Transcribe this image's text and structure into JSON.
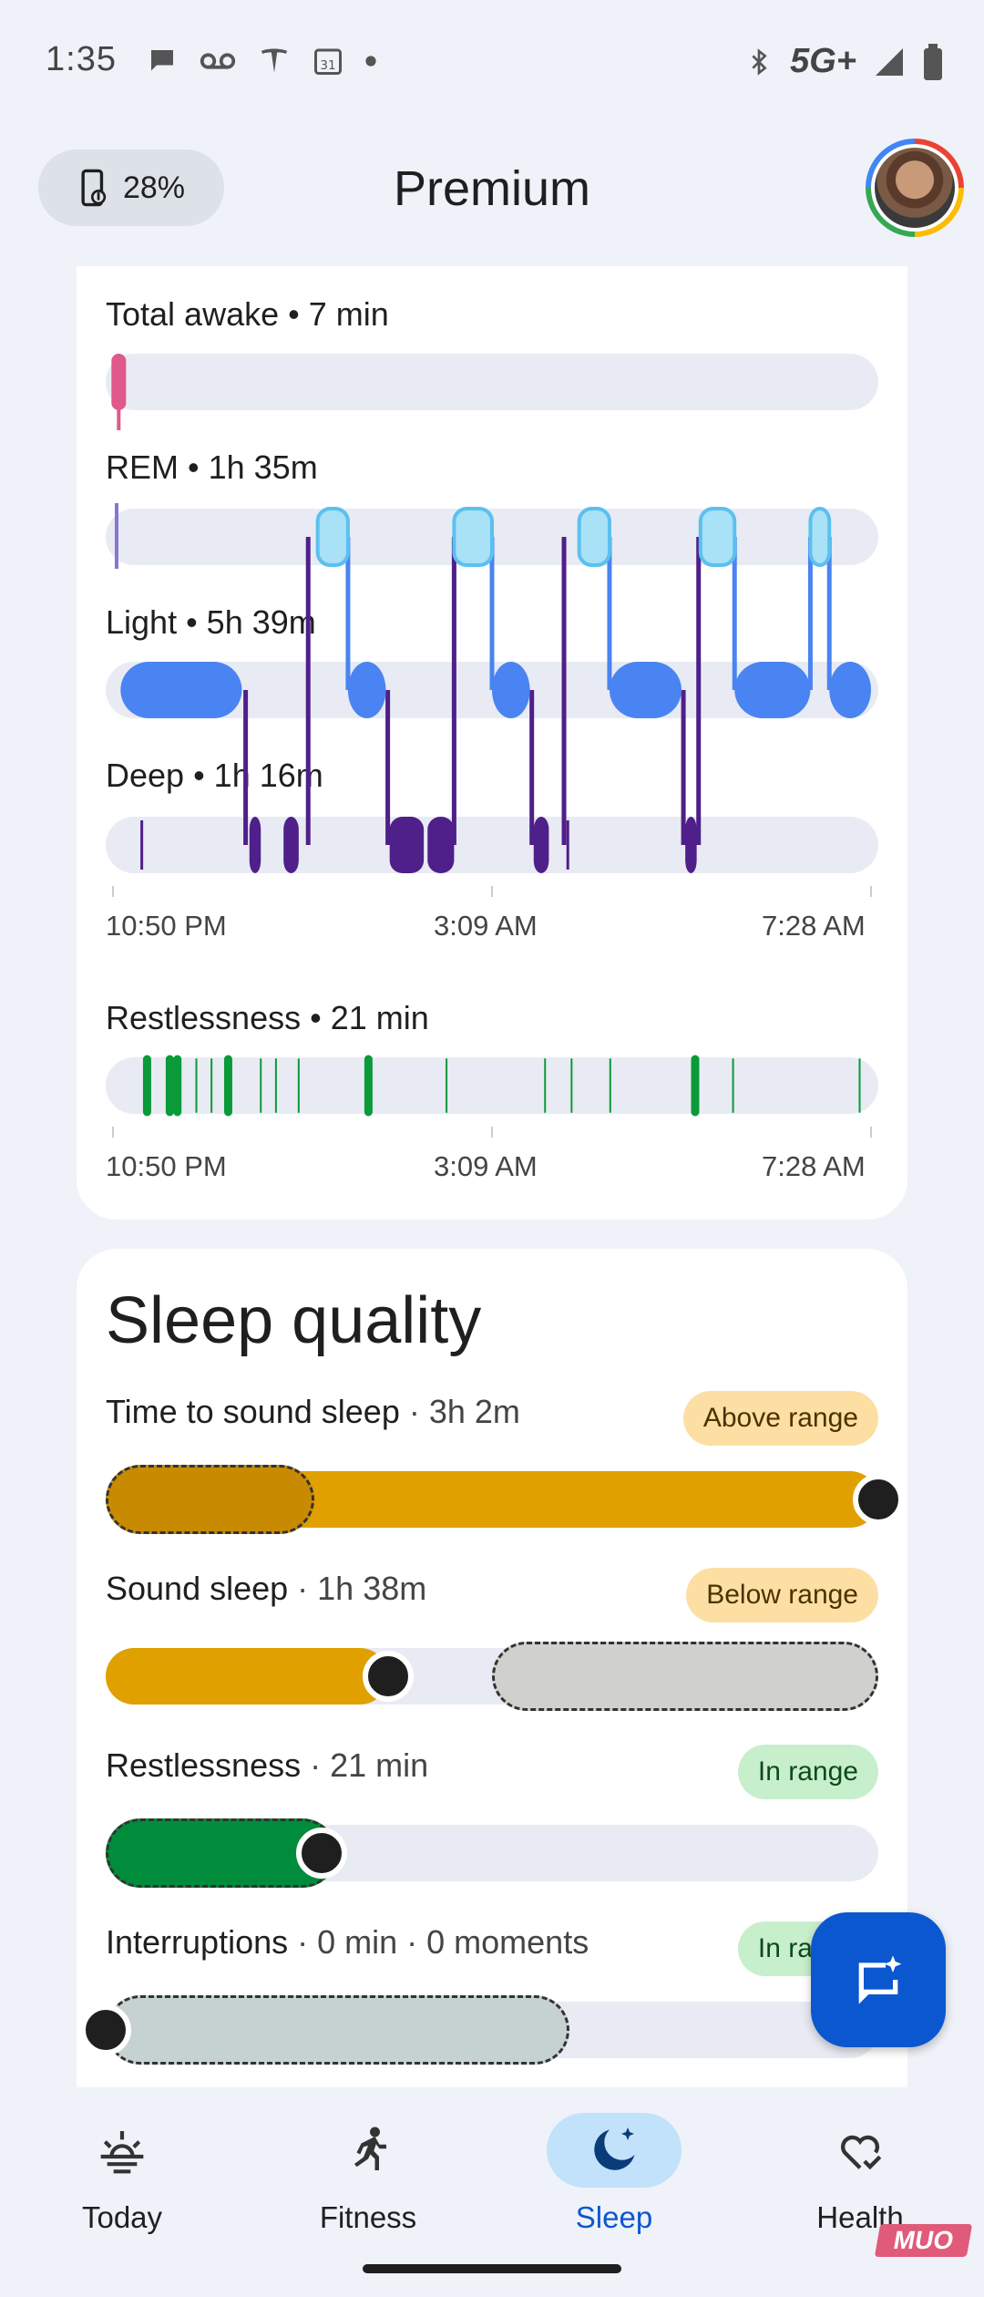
{
  "status_bar": {
    "time": "1:35",
    "network": "5G+",
    "left_icons": [
      "chat-bubble-icon",
      "voicemail-icon",
      "tesla-icon",
      "calendar-31-icon",
      "dot-icon"
    ],
    "right_icons": [
      "bluetooth-icon",
      "signal-icon",
      "battery-icon"
    ]
  },
  "header": {
    "battery_percent": "28%",
    "title": "Premium"
  },
  "sleep_stages": {
    "stages": [
      {
        "label": "Total awake • 7 min",
        "color": "#e0598b"
      },
      {
        "label": "REM • 1h 35m",
        "color": "#a9e1f7"
      },
      {
        "label": "Light • 5h 39m",
        "color": "#4a84f2"
      },
      {
        "label": "Deep • 1h 16m",
        "color": "#4f1f8a"
      }
    ],
    "time_axis": [
      "10:50 PM",
      "3:09 AM",
      "7:28 AM"
    ],
    "hypnogram": [
      {
        "stage": "light",
        "start": 0.01,
        "end": 0.17
      },
      {
        "stage": "deep",
        "start": 0.18,
        "end": 0.195
      },
      {
        "stage": "deep",
        "start": 0.225,
        "end": 0.245
      },
      {
        "stage": "rem",
        "start": 0.27,
        "end": 0.31
      },
      {
        "stage": "light",
        "start": 0.31,
        "end": 0.36
      },
      {
        "stage": "deep",
        "start": 0.365,
        "end": 0.41
      },
      {
        "stage": "deep",
        "start": 0.415,
        "end": 0.45
      },
      {
        "stage": "rem",
        "start": 0.45,
        "end": 0.5
      },
      {
        "stage": "light",
        "start": 0.5,
        "end": 0.55
      },
      {
        "stage": "deep",
        "start": 0.555,
        "end": 0.575
      },
      {
        "stage": "rem",
        "start": 0.615,
        "end": 0.655
      },
      {
        "stage": "light",
        "start": 0.655,
        "end": 0.75
      },
      {
        "stage": "deep",
        "start": 0.755,
        "end": 0.77
      },
      {
        "stage": "rem",
        "start": 0.775,
        "end": 0.82
      },
      {
        "stage": "light",
        "start": 0.82,
        "end": 0.92
      },
      {
        "stage": "rem",
        "start": 0.92,
        "end": 0.945
      },
      {
        "stage": "light",
        "start": 0.945,
        "end": 1.0
      }
    ],
    "awake_markers": [
      0.01
    ],
    "deep_ticks": [
      0.038,
      0.6
    ]
  },
  "restlessness_chart": {
    "label": "Restlessness • 21 min",
    "time_axis": [
      "10:50 PM",
      "3:09 AM",
      "7:28 AM"
    ],
    "marks": [
      {
        "t": 0.045,
        "strong": true
      },
      {
        "t": 0.075,
        "strong": true
      },
      {
        "t": 0.085,
        "strong": true
      },
      {
        "t": 0.11,
        "strong": false
      },
      {
        "t": 0.13,
        "strong": false
      },
      {
        "t": 0.152,
        "strong": true
      },
      {
        "t": 0.195,
        "strong": false
      },
      {
        "t": 0.215,
        "strong": false
      },
      {
        "t": 0.245,
        "strong": false
      },
      {
        "t": 0.337,
        "strong": true
      },
      {
        "t": 0.44,
        "strong": false
      },
      {
        "t": 0.57,
        "strong": false
      },
      {
        "t": 0.605,
        "strong": false
      },
      {
        "t": 0.656,
        "strong": false
      },
      {
        "t": 0.768,
        "strong": true
      },
      {
        "t": 0.818,
        "strong": false
      },
      {
        "t": 0.985,
        "strong": false
      }
    ]
  },
  "sleep_quality": {
    "title": "Sleep quality",
    "metrics": [
      {
        "name": "Time to sound sleep",
        "value": " · 3h 2m",
        "badge": "Above range",
        "badge_type": "above",
        "fill": 1.0,
        "fill_color": "#e0a000",
        "range": [
          0.0,
          0.27
        ],
        "range_color": "#c88a00",
        "marker": 1.0
      },
      {
        "name": "Sound sleep",
        "value": " · 1h 38m",
        "badge": "Below range",
        "badge_type": "below",
        "fill": 0.365,
        "fill_color": "#e0a000",
        "range": [
          0.5,
          1.0
        ],
        "range_color": "#d0d0cc",
        "marker": 0.365
      },
      {
        "name": "Restlessness",
        "value": " · 21 min",
        "badge": "In range",
        "badge_type": "inrange",
        "fill": 0.28,
        "fill_color": "#008c3a",
        "range": [
          0.0,
          0.3
        ],
        "range_color": "#008c3a",
        "marker": 0.28
      },
      {
        "name": "Interruptions",
        "value": " · 0 min · 0 moments",
        "badge": "In range",
        "badge_type": "inrange",
        "fill": 0.0,
        "fill_color": "#c8d0d0",
        "range": [
          0.0,
          0.6
        ],
        "range_color": "#c6d2d0",
        "marker": 0.0
      }
    ]
  },
  "bottom_nav": {
    "items": [
      {
        "label": "Today",
        "icon": "sunrise-icon",
        "active": false
      },
      {
        "label": "Fitness",
        "icon": "running-icon",
        "active": false
      },
      {
        "label": "Sleep",
        "icon": "moon-icon",
        "active": true
      },
      {
        "label": "Health",
        "icon": "heart-check-icon",
        "active": false
      }
    ]
  },
  "watermark": "MUO",
  "colors": {
    "accent": "#0b57d0",
    "awake": "#e0598b",
    "rem": "#a9e1f7",
    "light": "#4a84f2",
    "deep": "#4f1f8a",
    "restless": "#0a9a3a"
  }
}
